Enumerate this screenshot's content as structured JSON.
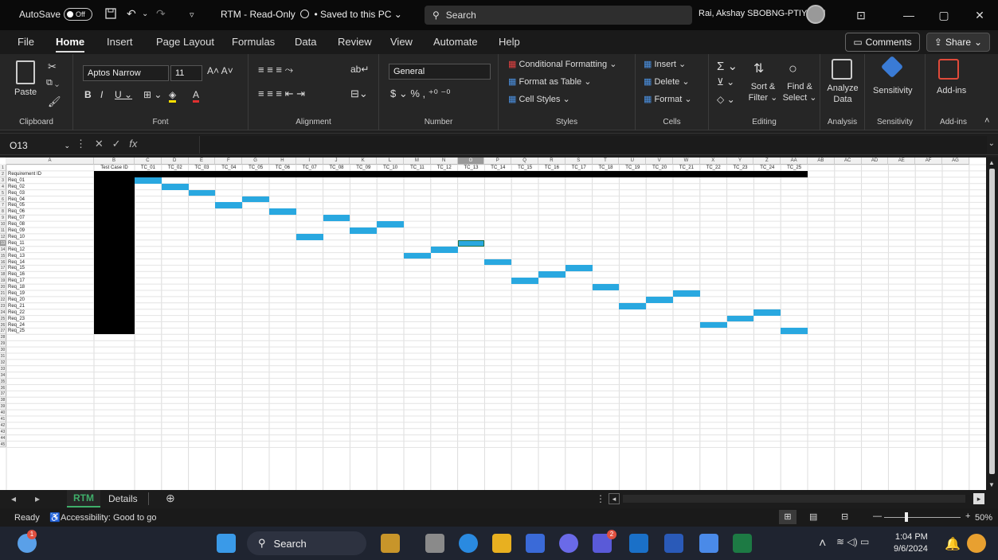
{
  "titlebar": {
    "autosave_label": "AutoSave",
    "autosave_state": "Off",
    "doc_title": "RTM  -  Read-Only",
    "save_status": "• Saved to this PC ⌄",
    "search_placeholder": "Search",
    "user": "Rai, Akshay SBOBNG-PTIY/BEJ"
  },
  "menu": {
    "items": [
      "File",
      "Home",
      "Insert",
      "Page Layout",
      "Formulas",
      "Data",
      "Review",
      "View",
      "Automate",
      "Help"
    ],
    "active": "Home",
    "comments": "Comments",
    "share": "Share"
  },
  "ribbon": {
    "paste": "Paste",
    "font_name": "Aptos Narrow",
    "font_size": "11",
    "number_format": "General",
    "conditional_formatting": "Conditional Formatting ⌄",
    "format_as_table": "Format as Table ⌄",
    "cell_styles": "Cell Styles ⌄",
    "insert": "Insert ⌄",
    "delete": "Delete ⌄",
    "format": "Format ⌄",
    "sort_filter": "Sort & Filter ⌄",
    "find_select": "Find & Select ⌄",
    "analyze": "Analyze Data",
    "sensitivity": "Sensitivity",
    "addins": "Add-ins",
    "groups": [
      "Clipboard",
      "Font",
      "Alignment",
      "Number",
      "Styles",
      "Cells",
      "Editing",
      "Analysis",
      "Sensitivity",
      "Add-ins"
    ]
  },
  "formula_bar": {
    "name_box": "O13",
    "fx": "fx",
    "value": ""
  },
  "sheet": {
    "columns": [
      "A",
      "B",
      "C",
      "D",
      "E",
      "F",
      "G",
      "H",
      "I",
      "J",
      "K",
      "L",
      "M",
      "N",
      "O",
      "P",
      "Q",
      "R",
      "S",
      "T",
      "U",
      "V",
      "W",
      "X",
      "Y",
      "Z",
      "AA",
      "AB",
      "AC",
      "AD",
      "AE",
      "AF",
      "AG"
    ],
    "selected_column": "O",
    "selected_row": 13,
    "header_row": [
      "Test Case ID",
      "TC_01",
      "TC_02",
      "TC_03",
      "TC_04",
      "TC_05",
      "TC_06",
      "TC_07",
      "TC_08",
      "TC_09",
      "TC_10",
      "TC_11",
      "TC_12",
      "TC_13",
      "TC_14",
      "TC_15",
      "TC_16",
      "TC_17",
      "TC_18",
      "TC_19",
      "TC_20",
      "TC_21",
      "TC_22",
      "TC_23",
      "TC_24",
      "TC_25"
    ],
    "req_header": "Requirement ID",
    "requirements": [
      "Req_01",
      "Req_02",
      "Req_03",
      "Req_04",
      "Req_05",
      "Req_06",
      "Req_07",
      "Req_08",
      "Req_09",
      "Req_10",
      "Req_11",
      "Req_12",
      "Req_13",
      "Req_14",
      "Req_15",
      "Req_16",
      "Req_17",
      "Req_18",
      "Req_19",
      "Req_20",
      "Req_21",
      "Req_22",
      "Req_23",
      "Req_24",
      "Req_25"
    ],
    "mapping_tc_index": [
      1,
      2,
      3,
      5,
      4,
      6,
      8,
      10,
      9,
      7,
      13,
      12,
      11,
      14,
      17,
      16,
      15,
      18,
      21,
      20,
      19,
      24,
      23,
      22,
      25
    ],
    "mark_color": "#29a8e0",
    "row_count": 45
  },
  "tabs": {
    "sheets": [
      "RTM",
      "Details"
    ],
    "active": "RTM"
  },
  "status": {
    "ready": "Ready",
    "accessibility": "Accessibility: Good to go",
    "zoom": "50%"
  },
  "taskbar": {
    "search": "Search",
    "time": "1:04 PM",
    "date": "9/6/2024",
    "teams_badge": "2"
  }
}
